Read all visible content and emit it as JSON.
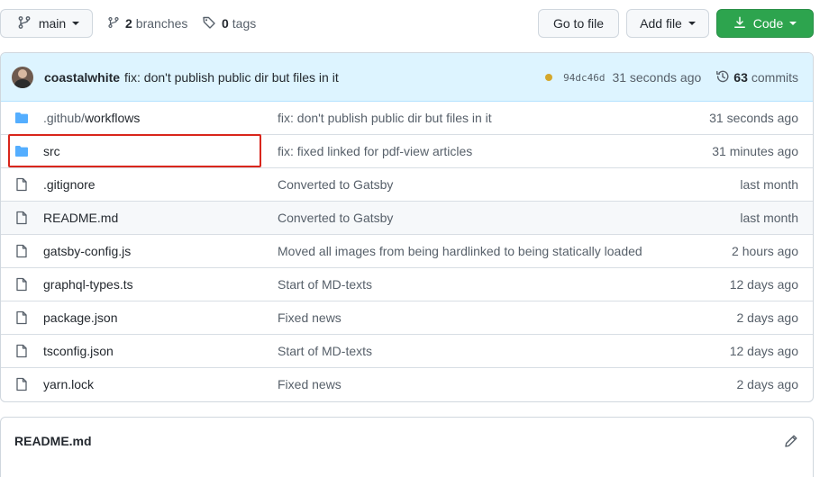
{
  "toolbar": {
    "branch": "main",
    "branches_count": "2",
    "branches_label": "branches",
    "tags_count": "0",
    "tags_label": "tags",
    "go_to_file": "Go to file",
    "add_file": "Add file",
    "code": "Code"
  },
  "commit": {
    "author": "coastalwhite",
    "message": "fix: don't publish public dir but files in it",
    "sha": "94dc46d",
    "ago": "31 seconds ago",
    "commits_count": "63",
    "commits_label": "commits",
    "status_color": "#d4a72c"
  },
  "files": [
    {
      "prefix": ".github/",
      "name": "workflows",
      "type": "folder",
      "message": "fix: don't publish public dir but files in it",
      "age": "31 seconds ago"
    },
    {
      "prefix": "",
      "name": "src",
      "type": "folder",
      "message": "fix: fixed linked for pdf-view articles",
      "age": "31 minutes ago"
    },
    {
      "prefix": "",
      "name": ".gitignore",
      "type": "file",
      "message": "Converted to Gatsby",
      "age": "last month"
    },
    {
      "prefix": "",
      "name": "README.md",
      "type": "file",
      "message": "Converted to Gatsby",
      "age": "last month"
    },
    {
      "prefix": "",
      "name": "gatsby-config.js",
      "type": "file",
      "message": "Moved all images from being hardlinked to being statically loaded",
      "age": "2 hours ago"
    },
    {
      "prefix": "",
      "name": "graphql-types.ts",
      "type": "file",
      "message": "Start of MD-texts",
      "age": "12 days ago"
    },
    {
      "prefix": "",
      "name": "package.json",
      "type": "file",
      "message": "Fixed news",
      "age": "2 days ago"
    },
    {
      "prefix": "",
      "name": "tsconfig.json",
      "type": "file",
      "message": "Start of MD-texts",
      "age": "12 days ago"
    },
    {
      "prefix": "",
      "name": "yarn.lock",
      "type": "file",
      "message": "Fixed news",
      "age": "2 days ago"
    }
  ],
  "readme": {
    "title": "README.md"
  },
  "colors": {
    "primary_button": "#2da44e",
    "folder_icon": "#54aeff",
    "commit_bar": "#ddf4ff",
    "highlight": "#d9261c"
  }
}
